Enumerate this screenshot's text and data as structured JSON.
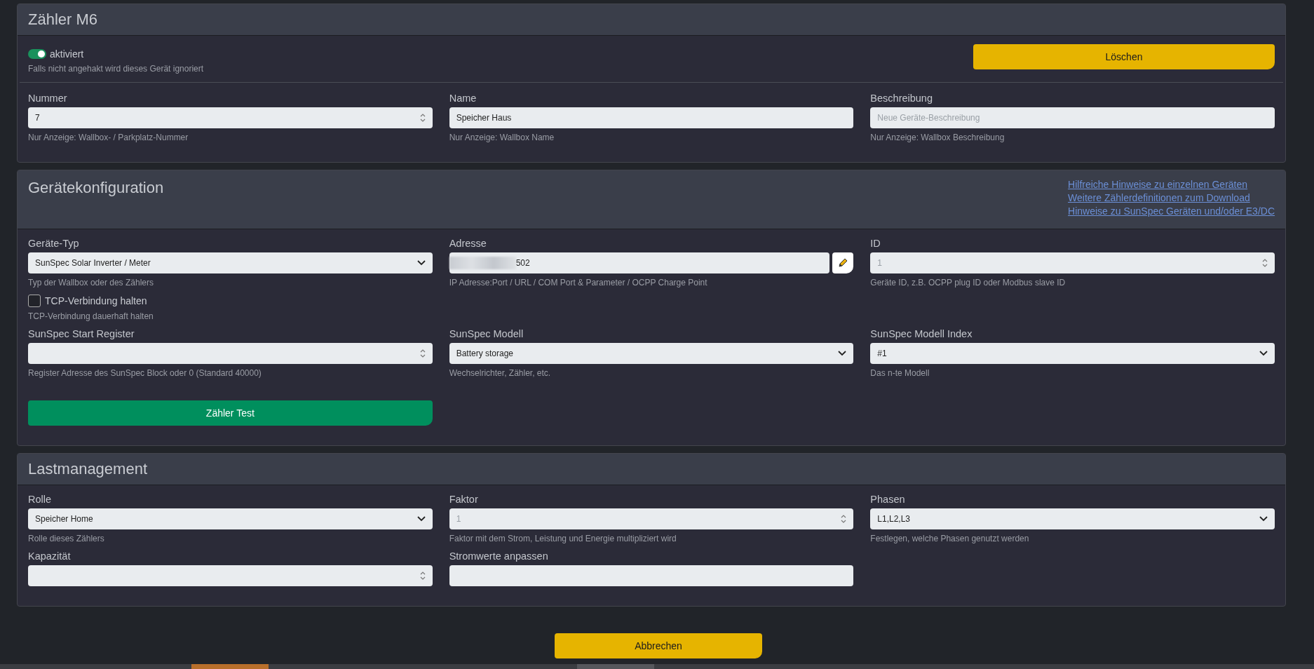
{
  "device_card": {
    "title": "Zähler M6",
    "enabled": {
      "label": "aktiviert",
      "on": true,
      "hint": "Falls nicht angehakt wird dieses Gerät ignoriert"
    },
    "delete_button": "Löschen",
    "rows": [
      [
        {
          "kind": "number",
          "label": "Nummer",
          "value": "7",
          "hint": "Nur Anzeige: Wallbox- / Parkplatz-Nummer"
        },
        {
          "kind": "text",
          "label": "Name",
          "value": "Speicher Haus",
          "hint": "Nur Anzeige: Wallbox Name"
        },
        {
          "kind": "text",
          "label": "Beschreibung",
          "placeholder": "Neue Geräte-Beschreibung",
          "hint": "Nur Anzeige: Wallbox Beschreibung"
        }
      ]
    ]
  },
  "config_card": {
    "title": "Gerätekonfiguration",
    "links": [
      "Hilfreiche Hinweise zu einzelnen Geräten",
      "Weitere Zählerdefinitionen zum Download",
      "Hinweise zu SunSpec Geräten und/oder E3/DC"
    ],
    "rows": [
      [
        {
          "kind": "select",
          "label": "Geräte-Typ",
          "value": "SunSpec Solar Inverter / Meter",
          "hint": "Typ der Wallbox oder des Zählers"
        },
        {
          "kind": "address",
          "label": "Adresse",
          "value": "502",
          "hint": "IP Adresse:Port / URL / COM Port & Parameter / OCPP Charge Point"
        },
        {
          "kind": "number",
          "label": "ID",
          "placeholder": "1",
          "hint": "Geräte ID, z.B. OCPP plug ID oder Modbus slave ID"
        }
      ],
      [
        {
          "kind": "checkbox",
          "label": "TCP-Verbindung halten",
          "checked": false,
          "hint": "TCP-Verbindung dauerhaft halten"
        }
      ],
      [
        {
          "kind": "number",
          "label": "SunSpec Start Register",
          "hint": "Register Adresse des SunSpec Block oder 0 (Standard 40000)"
        },
        {
          "kind": "select",
          "label": "SunSpec Modell",
          "value": "Battery storage",
          "hint": "Wechselrichter, Zähler, etc."
        },
        {
          "kind": "select",
          "label": "SunSpec Modell Index",
          "value": "#1",
          "hint": "Das n-te Modell"
        }
      ]
    ],
    "test_button": "Zähler Test"
  },
  "load_card": {
    "title": "Lastmanagement",
    "rows": [
      [
        {
          "kind": "select",
          "label": "Rolle",
          "value": "Speicher Home",
          "hint": "Rolle dieses Zählers"
        },
        {
          "kind": "number",
          "label": "Faktor",
          "placeholder": "1",
          "hint": "Faktor mit dem Strom, Leistung und Energie multipliziert wird"
        },
        {
          "kind": "select",
          "label": "Phasen",
          "value": "L1,L2,L3",
          "hint": "Festlegen, welche Phasen genutzt werden"
        }
      ],
      [
        {
          "kind": "number",
          "label": "Kapazität"
        },
        {
          "kind": "text",
          "label": "Stromwerte anpassen"
        }
      ]
    ]
  },
  "cancel_button": "Abbrechen"
}
